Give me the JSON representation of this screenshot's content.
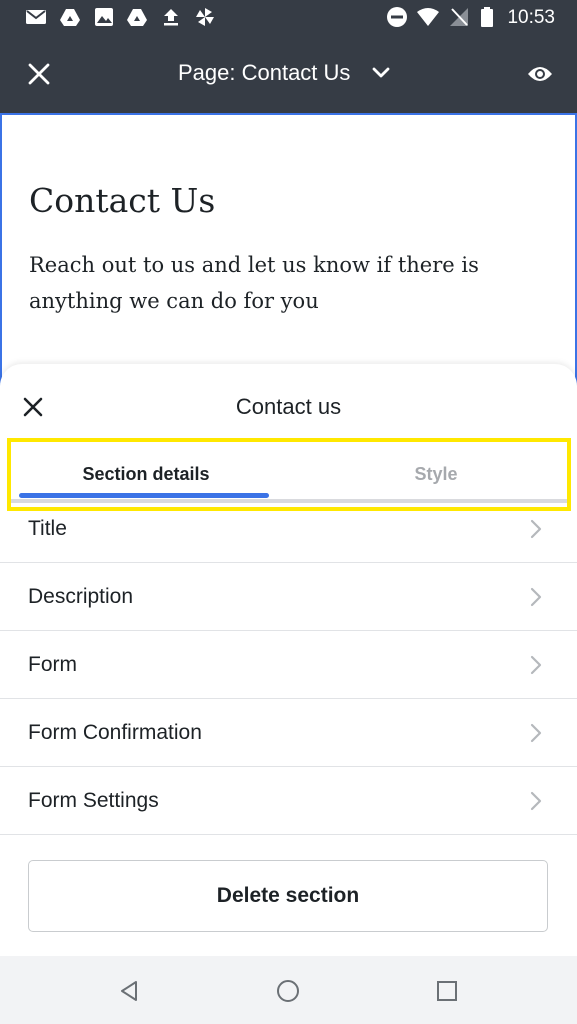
{
  "status_bar": {
    "time": "10:53",
    "left_icons": [
      "mail-icon",
      "drive-icon",
      "photos-icon",
      "drive-icon",
      "upload-icon",
      "pinwheel-icon"
    ],
    "right_icons": [
      "do-not-disturb-icon",
      "wifi-icon",
      "no-signal-icon",
      "battery-icon"
    ]
  },
  "app_bar": {
    "page_title": "Page: Contact Us",
    "close_icon": "close-icon",
    "dropdown_icon": "chevron-down-icon",
    "preview_icon": "eye-icon"
  },
  "preview": {
    "heading": "Contact Us",
    "body": "Reach out to us and let us know if there is anything we can do for you"
  },
  "sheet": {
    "title": "Contact us",
    "tabs": [
      {
        "label": "Section details",
        "active": true
      },
      {
        "label": "Style",
        "active": false
      }
    ],
    "items": [
      {
        "label": "Title"
      },
      {
        "label": "Description"
      },
      {
        "label": "Form"
      },
      {
        "label": "Form Confirmation"
      },
      {
        "label": "Form Settings"
      }
    ],
    "delete_label": "Delete section"
  },
  "colors": {
    "app_bar": "#363c45",
    "accent": "#3b73e6",
    "highlight": "#ffe800",
    "inactive_tab": "#a6a9ad"
  }
}
